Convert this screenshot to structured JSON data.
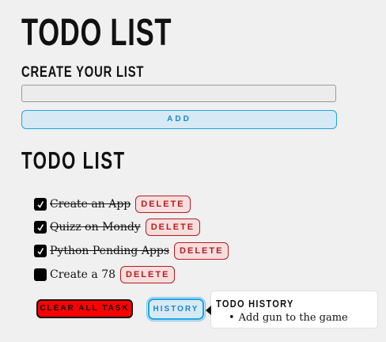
{
  "header": {
    "title": "TODO LIST"
  },
  "create": {
    "label": "CREATE YOUR LIST",
    "input_value": "",
    "placeholder": "",
    "add_label": "ADD"
  },
  "list": {
    "heading": "TODO LIST",
    "items": [
      {
        "text": "Create an App",
        "done": true,
        "delete_label": "DELETE"
      },
      {
        "text": "Quizz on Mondy",
        "done": true,
        "delete_label": "DELETE"
      },
      {
        "text": "Python Pending Apps",
        "done": true,
        "delete_label": "DELETE"
      },
      {
        "text": "Create a 78",
        "done": false,
        "delete_label": "DELETE"
      }
    ]
  },
  "actions": {
    "clear_label": "CLEAR ALL TASK",
    "history_label": "HISTORY"
  },
  "history": {
    "title": "TODO HISTORY",
    "items": [
      "Add gun to the game"
    ]
  },
  "colors": {
    "accent_blue": "#1fa4e6",
    "delete_red": "#b71c1c",
    "clear_red": "#ff0000",
    "background": "#f0f0f0"
  },
  "icons": {
    "checkbox_checked": "checkmark-icon",
    "tooltip_arrow": "arrow-left-icon"
  }
}
